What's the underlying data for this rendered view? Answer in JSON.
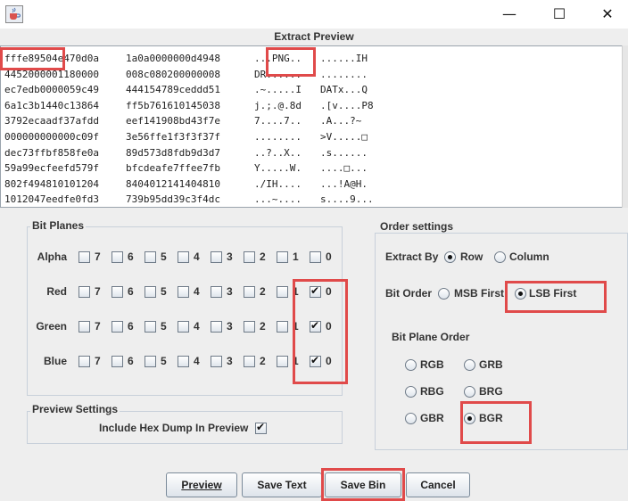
{
  "window": {
    "app_icon": "java-cup-icon",
    "minimize": "—",
    "maximize": "☐",
    "close": "✕"
  },
  "preview": {
    "title": "Extract Preview",
    "lines": [
      {
        "hex1": "fffe89504e470d0a",
        "hex2": "1a0a0000000d4948",
        "ascii1": "...PNG..",
        "ascii2": "......IH"
      },
      {
        "hex1": "4452000001180000",
        "hex2": "008c080200000008",
        "ascii1": "DR......",
        "ascii2": "........"
      },
      {
        "hex1": "ec7edb0000059c49",
        "hex2": "444154789ceddd51",
        "ascii1": ".~.....I",
        "ascii2": "DATx...Q"
      },
      {
        "hex1": "6a1c3b1440c13864",
        "hex2": "ff5b761610145038",
        "ascii1": "j.;.@.8d",
        "ascii2": ".[v....P8"
      },
      {
        "hex1": "3792ecaadf37afdd",
        "hex2": "eef141908bd43f7e",
        "ascii1": "7....7..",
        "ascii2": ".A...?~"
      },
      {
        "hex1": "000000000000c09f",
        "hex2": "3e56ffe1f3f3f37f",
        "ascii1": "........",
        "ascii2": ">V.....□"
      },
      {
        "hex1": "dec73ffbf858fe0a",
        "hex2": "89d573d8fdb9d3d7",
        "ascii1": "..?..X..",
        "ascii2": ".s......"
      },
      {
        "hex1": "59a99ecfeefd579f",
        "hex2": "bfcdeafe7ffee7fb",
        "ascii1": "Y.....W.",
        "ascii2": "....□..."
      },
      {
        "hex1": "802f494810101204",
        "hex2": "8404012141404810",
        "ascii1": "./IH....",
        "ascii2": "...!A@H."
      },
      {
        "hex1": "1012047eedfe0fd3",
        "hex2": "739b95dd39c3f4dc",
        "ascii1": "...~....",
        "ascii2": "s....9..."
      }
    ]
  },
  "bit_planes": {
    "title": "Bit Planes",
    "bits": [
      "7",
      "6",
      "5",
      "4",
      "3",
      "2",
      "1",
      "0"
    ],
    "rows": [
      {
        "label": "Alpha",
        "checked": [
          false,
          false,
          false,
          false,
          false,
          false,
          false,
          false
        ]
      },
      {
        "label": "Red",
        "checked": [
          false,
          false,
          false,
          false,
          false,
          false,
          false,
          true
        ]
      },
      {
        "label": "Green",
        "checked": [
          false,
          false,
          false,
          false,
          false,
          false,
          false,
          true
        ]
      },
      {
        "label": "Blue",
        "checked": [
          false,
          false,
          false,
          false,
          false,
          false,
          false,
          true
        ]
      }
    ]
  },
  "preview_settings": {
    "title": "Preview Settings",
    "include_hex_label": "Include Hex Dump In Preview",
    "include_hex_checked": true
  },
  "order_settings": {
    "title": "Order settings",
    "extract_by_label": "Extract By",
    "row_label": "Row",
    "column_label": "Column",
    "extract_by_selected": "Row",
    "bit_order_label": "Bit Order",
    "msb_label": "MSB First",
    "lsb_label": "LSB First",
    "bit_order_selected": "LSB First",
    "bit_plane_order_label": "Bit Plane Order",
    "plane_options": [
      "RGB",
      "GRB",
      "RBG",
      "BRG",
      "GBR",
      "BGR"
    ],
    "plane_selected": "BGR"
  },
  "buttons": {
    "preview": "Preview",
    "save_text": "Save Text",
    "save_bin": "Save Bin",
    "cancel": "Cancel"
  },
  "highlight_color": "#e04a4a"
}
